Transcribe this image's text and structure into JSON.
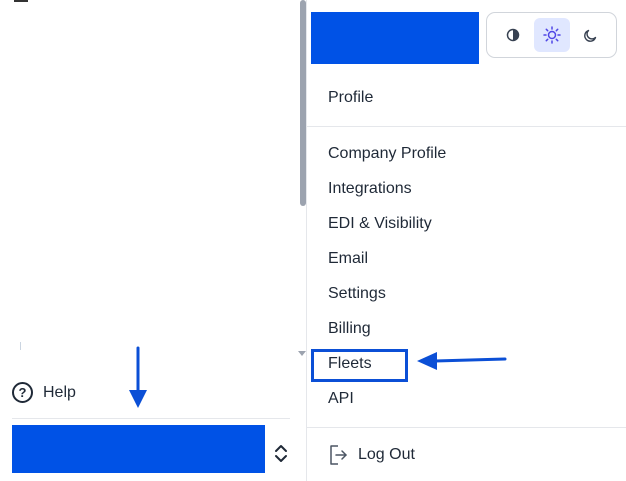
{
  "sidebar": {
    "help_label": "Help"
  },
  "theme_toggle": {
    "options": [
      "contrast-icon",
      "sun-icon",
      "moon-icon"
    ],
    "active": "sun-icon"
  },
  "menu": {
    "profile": "Profile",
    "items": [
      "Company Profile",
      "Integrations",
      "EDI & Visibility",
      "Email",
      "Settings",
      "Billing",
      "Fleets",
      "API"
    ],
    "logout": "Log Out"
  },
  "colors": {
    "brand": "#0052e6",
    "annotation": "#0b4fd6",
    "active_theme_bg": "#e0e7ff"
  }
}
